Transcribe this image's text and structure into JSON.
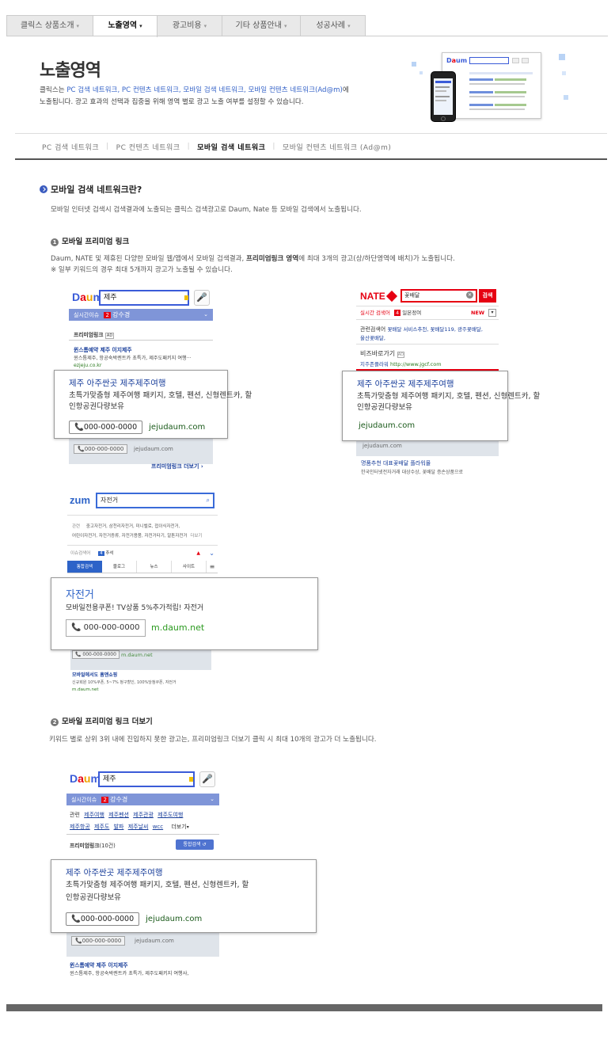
{
  "tabs": [
    {
      "label": "클릭스 상품소개",
      "active": false
    },
    {
      "label": "노출영역",
      "active": true
    },
    {
      "label": "광고비용",
      "active": false
    },
    {
      "label": "기타 상품안내",
      "active": false
    },
    {
      "label": "성공사례",
      "active": false
    }
  ],
  "hero": {
    "title": "노출영역",
    "intro_prefix": "클릭스는 ",
    "intro_links": "PC 검색 네트워크, PC 컨텐츠 네트워크, 모바일 검색 네트워크, 모바일 컨텐츠 네트워크(Ad@m)",
    "intro_suffix": "에",
    "intro_line2": "노출됩니다. 광고 효과의 선택과 집중을 위해 영역 별로 광고 노출 여부를 설정할 수 있습니다."
  },
  "subnav": [
    {
      "label": "PC 검색 네트워크",
      "active": false
    },
    {
      "label": "PC 컨텐츠 네트워크",
      "active": false
    },
    {
      "label": "모바일 검색 네트워크",
      "active": true
    },
    {
      "label": "모바일 컨텐츠 네트워크 (Ad@m)",
      "active": false
    }
  ],
  "section": {
    "title": "모바일 검색 네트워크란?",
    "desc": "모바일 인터넷 검색시 검색결과에 노출되는 클릭스 검색광고로 Daum, Nate 등 모바일 검색에서 노출됩니다."
  },
  "item1": {
    "num": "1",
    "title": "모바일 프리미엄 링크",
    "desc_a_pre": "Daum, NATE 및 제휴된 다양한 모바일 웹/앱에서 모바일 검색결과, ",
    "desc_a_bold": "프리미엄링크 영역",
    "desc_a_post": "에 최대 3개의 광고(상/하단영역에 배치)가 노출됩니다.",
    "desc_b": "※ 일부 키워드의 경우 최대 5개까지 광고가 노출될 수 있습니다."
  },
  "item2": {
    "num": "2",
    "title": "모바일 프리미엄 링크 더보기",
    "desc": "키워드 별로 상위 3위 내에 진입하지 못한 광고는, 프리미엄링크 더보기 클릭 시 최대 10개의 광고가 더 노출됩니다."
  },
  "daum1": {
    "logo": "Daum",
    "query": "제주",
    "bar_label": "실시간이슈",
    "bar_rank": "2",
    "bar_text": "강수경",
    "section_label": "프리미엄링크",
    "ad_badge": "AD",
    "bg_ad_title": "윈스톰예약 제주 이지제주",
    "bg_ad_desc": "윈스톰제주, 항공숙박렌트카 초특가, 제주도패키지 여행···",
    "bg_ad_url": "ezjeju.co.kr",
    "bg_phone": "000-000-0000",
    "bg_url": "jejudaum.com",
    "more": "프리미엄링크 더보기 ›"
  },
  "adJeju": {
    "title": "제주 아주싼곳 제주제주여행",
    "desc1": "초특가맞춤형 제주여행 패키지, 호텔, 펜션, 신형렌트카, 할",
    "desc2": "인항공권다량보유",
    "phone": "000-000-0000",
    "url": "jejudaum.com"
  },
  "nate": {
    "logo": "NATE",
    "query": "꽃배달",
    "search_btn": "검색",
    "bar_label": "실시간 검색어",
    "bar_rank": "4",
    "bar_text": "일본정여",
    "new_label": "NEW",
    "related_label": "관련검색어",
    "related_text": "꽃배달 서비스추천, 꽃배달119, 광주꽃배달,",
    "related_text2": "울산꽃배달,",
    "biz_label": "비즈바로가기",
    "biz_text": "지주존플라워",
    "biz_url": "http://www.jgcf.com",
    "bg_url": "jejudaum.com",
    "bg_ad_title": "명품추천 대표꽃배달 플라워몰",
    "bg_ad_desc": "한국인터넷전자거래 대상수상, 꽃배달 증손상품으로"
  },
  "zum": {
    "logo": "zum",
    "query": "자전거",
    "related_label": "관련",
    "related1": "중고자전거, 삼천리자전거, 미니벨로, 접이식자전거,",
    "related2": "어린이자전거, 자전거증류, 자전거용품, 자전거타기, 알톤자전거",
    "related_more": "더보기",
    "issue_label": "이슈검색어",
    "issue_rank": "4",
    "issue_text": "추석",
    "tabs": [
      "통합검색",
      "블로그",
      "뉴스",
      "사이트"
    ],
    "ad_title": "자전거",
    "ad_desc": "모바일전용쿠폰! TV상품 5%추가적립! 자전거",
    "phone": "000-000-0000",
    "url": "m.daum.net",
    "bg_phone": "000-000-0000",
    "bg_url": "m.daum.net",
    "bg_ad_title": "모바일에서도 홈앤쇼핑",
    "bg_ad_desc": "신규회원 10%쿠폰, 5~7% 청구할인, 100%당첨쿠폰, 자전거",
    "bg_ad_url": "m.daum.net"
  },
  "daum2": {
    "logo": "Daum",
    "query": "제주",
    "bar_label": "실시간이슈",
    "bar_rank": "2",
    "bar_text": "강수경",
    "related_label": "관련",
    "related": [
      "제주여행",
      "제주펜션",
      "제주관광",
      "제주도여행"
    ],
    "related2": [
      "제주항공",
      "제주도",
      "발파",
      "제주날씨",
      "wcc"
    ],
    "related_more": "더보기",
    "section_label": "프리미엄링크",
    "section_count": "(10건)",
    "all_btn": "통합검색",
    "bg_phone": "000-000-0000",
    "bg_url": "jejudaum.com",
    "bg_ad_title": "윈스톰예약 제주 이지제주",
    "bg_ad_desc": "윈스톰제주, 항공숙박렌트카 초특가, 제주도패키지 여행사,"
  },
  "colors": {
    "accent_blue": "#3563c8",
    "link_blue": "#1a3f9b",
    "url_green": "#2b7a1f",
    "nate_red": "#e60012"
  },
  "icons": [
    "phone-icon",
    "mic-icon",
    "search-icon",
    "chevron-down-icon",
    "menu-icon"
  ]
}
